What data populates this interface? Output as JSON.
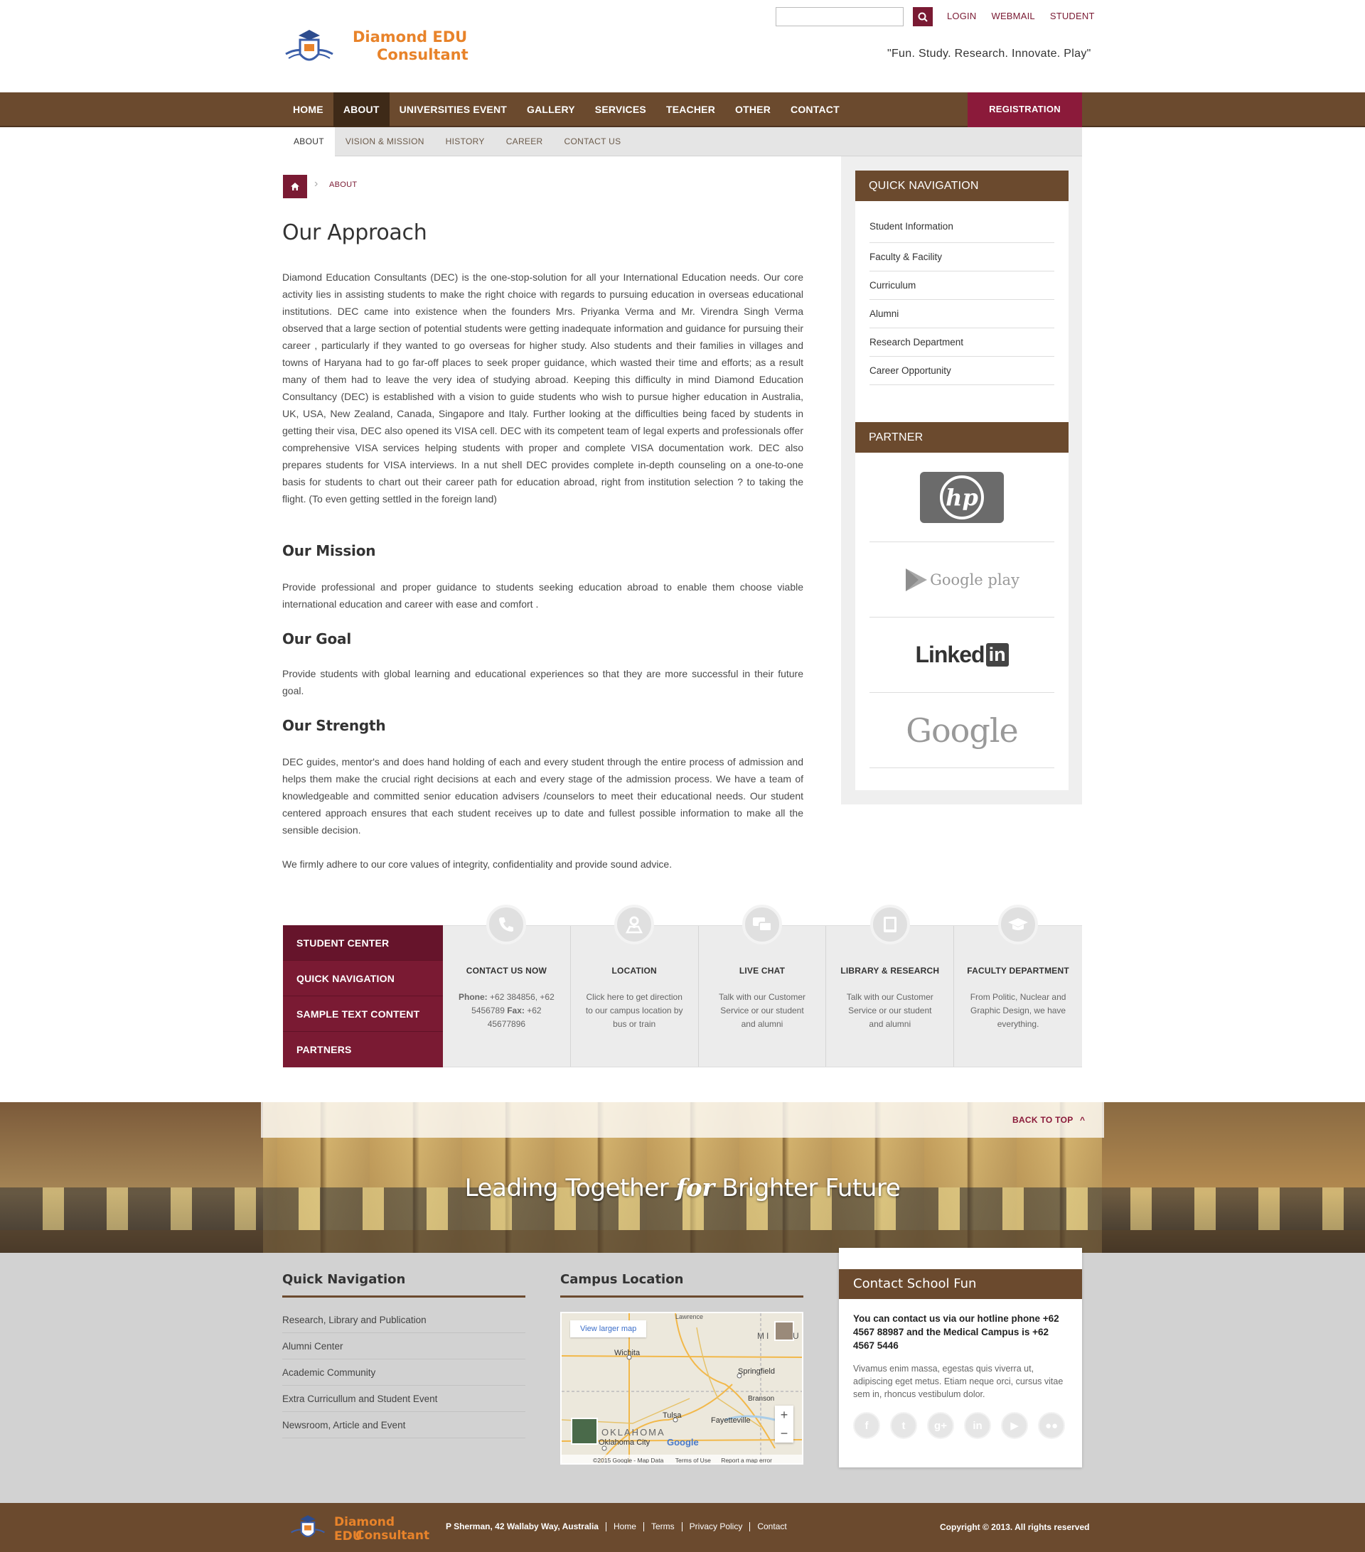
{
  "header": {
    "logo_line1": "Diamond EDU",
    "logo_line2": "Consultant",
    "search_placeholder": "",
    "top_links": [
      "LOGIN",
      "WEBMAIL",
      "STUDENT"
    ],
    "tagline": "\"Fun. Study. Research. Innovate. Play\""
  },
  "nav": {
    "items": [
      "HOME",
      "ABOUT",
      "UNIVERSITIES EVENT",
      "GALLERY",
      "SERVICES",
      "TEACHER",
      "OTHER",
      "CONTACT"
    ],
    "active": "ABOUT",
    "registration": "REGISTRATION"
  },
  "subnav": {
    "items": [
      "ABOUT",
      "VISION & MISSION",
      "HISTORY",
      "CAREER",
      "CONTACT US"
    ],
    "active": "ABOUT"
  },
  "breadcrumb": {
    "current": "ABOUT"
  },
  "content": {
    "title": "Our Approach",
    "approach": "Diamond Education Consultants (DEC) is the one-stop-solution for all your International Education needs. Our core activity lies in assisting students to make the right choice with regards to pursuing education in overseas educational institutions. DEC came into existence when the founders Mrs. Priyanka Verma and Mr. Virendra Singh Verma observed that a large section of potential students were getting inadequate information and guidance for pursuing their career , particularly if they wanted to go overseas for higher study. Also students and their families in villages and towns of Haryana had to go far-off places to seek proper guidance, which wasted their time and efforts; as a result many of them had to leave the very idea of studying abroad. Keeping this difficulty in mind Diamond Education Consultancy (DEC) is established with a vision to guide students who wish to pursue higher education in Australia, UK, USA, New Zealand, Canada, Singapore and Italy. Further looking at the difficulties being faced by students in getting their visa, DEC also opened its VISA cell. DEC with its competent team of legal experts and professionals offer comprehensive VISA services helping students with proper and complete VISA documentation work. DEC also prepares students for VISA interviews. In a nut shell DEC provides complete in-depth counseling on a one-to-one basis for students to chart out their career path for education abroad, right from institution selection ? to taking the flight. (To even getting settled in the foreign land)",
    "mission_title": "Our Mission",
    "mission": "Provide professional and proper guidance to students seeking education abroad to enable them choose viable international education and career with ease and comfort .",
    "goal_title": "Our Goal",
    "goal": "Provide students with global learning and educational experiences so that they are more successful in their future goal.",
    "strength_title": "Our Strength",
    "strength": "DEC guides, mentor's and does hand holding of each and every student through the entire process of admission and helps them make the crucial right decisions at each and every stage of the admission process. We have a team of knowledgeable and committed senior education advisers /counselors to meet their educational needs. Our student centered approach ensures that each student receives up to date and fullest possible information to make all the sensible decision.",
    "values": "We firmly adhere to our core values of integrity, confidentiality and provide sound advice."
  },
  "sidebar": {
    "quick_nav_title": "QUICK NAVIGATION",
    "quick_nav": [
      "Student Information",
      "Faculty & Facility",
      "Curriculum",
      "Alumni",
      "Research Department",
      "Career Opportunity"
    ],
    "partner_title": "PARTNER",
    "partners": {
      "hp": "hp",
      "google_play": "Google play",
      "linkedin": "Linked",
      "linkedin_in": "in",
      "google": "Google"
    }
  },
  "strip": {
    "tabs": [
      "STUDENT CENTER",
      "QUICK NAVIGATION",
      "SAMPLE TEXT CONTENT",
      "PARTNERS"
    ],
    "cols": [
      {
        "icon": "phone-icon",
        "title": "CONTACT US NOW",
        "phone_label": "Phone:",
        "phone": "+62 384856, +62 5456789",
        "fax_label": "Fax:",
        "fax": "+62 45677896"
      },
      {
        "icon": "map-pin-icon",
        "title": "LOCATION",
        "text": "Click here to get direction to our campus location by bus or train"
      },
      {
        "icon": "chat-icon",
        "title": "LIVE CHAT",
        "text": "Talk with our Customer Service or our student and alumni"
      },
      {
        "icon": "book-icon",
        "title": "LIBRARY & RESEARCH",
        "text": "Talk with our Customer Service or our student and alumni"
      },
      {
        "icon": "graduation-cap-icon",
        "title": "FACULTY DEPARTMENT",
        "text": "From Politic, Nuclear and Graphic Design, we have everything."
      }
    ]
  },
  "banner": {
    "back_to_top": "BACK TO TOP",
    "text_before": "Leading Together",
    "text_em": "for",
    "text_after": "Brighter Future"
  },
  "footer": {
    "quick_nav_title": "Quick Navigation",
    "quick_nav": [
      "Research, Library and Publication",
      "Alumni Center",
      "Academic Community",
      "Extra Curricullum and Student Event",
      "Newsroom, Article and Event"
    ],
    "campus_title": "Campus Location",
    "map": {
      "larger": "View larger map",
      "places": [
        "Lawrence",
        "Wichita",
        "MI",
        "U",
        "Springfield",
        "Branson",
        "Tulsa",
        "Fayetteville",
        "OKLAHOMA",
        "Oklahoma City",
        "Google"
      ],
      "credits": "©2015 Google - Map Data",
      "terms": "Terms of Use",
      "report": "Report a map error",
      "zoom_in": "+",
      "zoom_out": "−"
    },
    "contact_title": "Contact School Fun",
    "contact_bold": "You can contact us via our hotline phone +62 4567 88987 and the Medical Campus is +62 4567 5446",
    "contact_text": "Vivamus enim massa, egestas quis viverra ut, adipiscing eget metus. Etiam neque orci, cursus vitae sem in, rhoncus vestibulum dolor.",
    "socials": [
      {
        "icon": "facebook-icon",
        "glyph": "f"
      },
      {
        "icon": "twitter-icon",
        "glyph": "t"
      },
      {
        "icon": "google-plus-icon",
        "glyph": "g+"
      },
      {
        "icon": "linkedin-icon",
        "glyph": "in"
      },
      {
        "icon": "youtube-icon",
        "glyph": "▶"
      },
      {
        "icon": "flickr-icon",
        "glyph": "●●"
      }
    ]
  },
  "bottom": {
    "logo_line1": "Diamond EDU",
    "logo_line2": "Consultant",
    "address": "P Sherman, 42 Wallaby Way, Australia",
    "links": [
      "Home",
      "Terms",
      "Privacy Policy",
      "Contact"
    ],
    "copyright": "Copyright © 2013. All rights reserved"
  },
  "colors": {
    "brown": "#6b4a2e",
    "maroon": "#7a1a33",
    "orange": "#e8832a"
  }
}
